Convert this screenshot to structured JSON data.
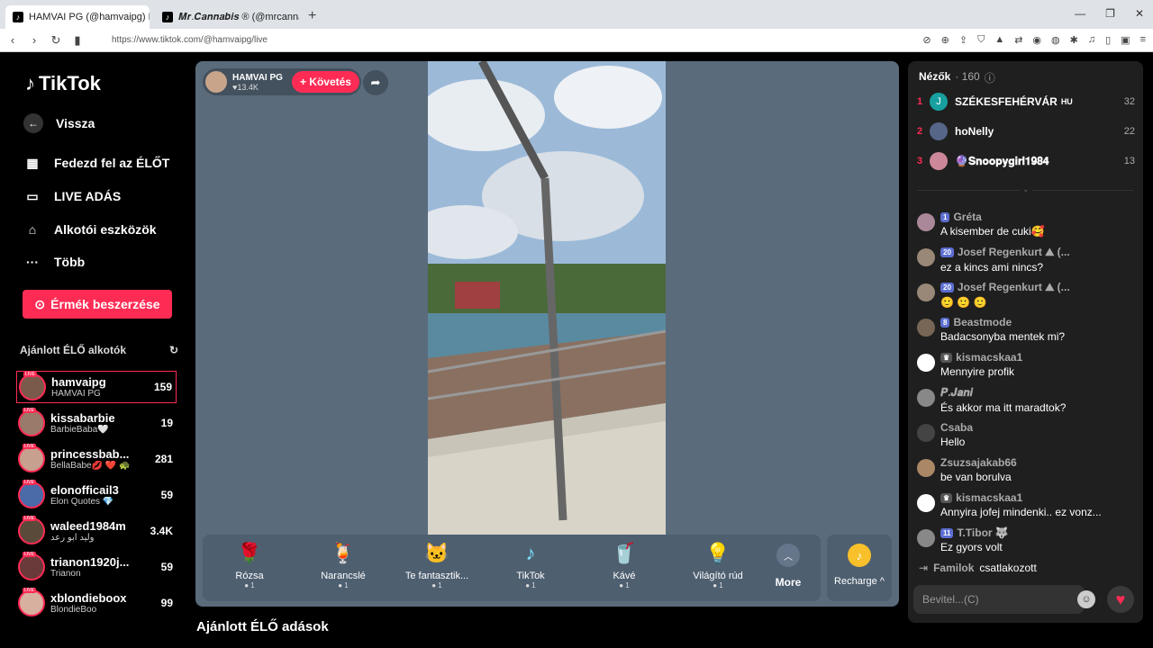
{
  "browser": {
    "tabs": [
      {
        "label": "HAMVAI PG (@hamvaipg) ÉL",
        "active": true
      },
      {
        "label": "𝑴𝒓.𝑪𝒂𝒏𝒏𝒂𝒃𝒊𝒔 ® (@mrcannab",
        "active": false
      }
    ],
    "url": "https://www.tiktok.com/@hamvaipg/live"
  },
  "sidebar": {
    "logo": "TikTok",
    "back": "Vissza",
    "nav": [
      "Fedezd fel az ÉLŐT",
      "LIVE ADÁS",
      "Alkotói eszközök",
      "Több"
    ],
    "coins_button": "Érmék beszerzése",
    "recommended_title": "Ajánlott ÉLŐ alkotók",
    "creators": [
      {
        "name": "hamvaipg",
        "sub": "HAMVAI PG",
        "count": "159",
        "selected": true,
        "color": "#7a5a4a"
      },
      {
        "name": "kissabarbie",
        "sub": "BarbieBaba🤍",
        "count": "19",
        "color": "#9a7a6a"
      },
      {
        "name": "princessbab...",
        "sub": "BellaBabe💋 ❤️ 🐢",
        "count": "281",
        "color": "#c8a090"
      },
      {
        "name": "elonofficail3",
        "sub": "Elon Quotes 💎",
        "count": "59",
        "color": "#4a6aa8"
      },
      {
        "name": "waleed1984m",
        "sub": "وليد ابو رعد",
        "count": "3.4K",
        "color": "#5a4a3a"
      },
      {
        "name": "trianon1920j...",
        "sub": "Trianon",
        "count": "59",
        "color": "#6a3a3a"
      },
      {
        "name": "xblondieboox",
        "sub": "BlondieBoo",
        "count": "99",
        "color": "#d8b0a0"
      }
    ]
  },
  "player": {
    "host_name": "HAMVAI PG",
    "host_likes": "♥13.4K",
    "follow": "+ Követés",
    "gifts": [
      {
        "icon": "🌹",
        "name": "Rózsa",
        "price": "1"
      },
      {
        "icon": "🍹",
        "name": "Narancslé",
        "price": "1"
      },
      {
        "icon": "🐱",
        "name": "Te fantasztik...",
        "price": "1"
      },
      {
        "icon": "♪",
        "name": "TikTok",
        "price": "1"
      },
      {
        "icon": "🥤",
        "name": "Kávé",
        "price": "1"
      },
      {
        "icon": "💡",
        "name": "Világító rúd",
        "price": "1"
      }
    ],
    "more": "More",
    "recharge": "Recharge ^",
    "below_title": "Ajánlott ÉLŐ adások"
  },
  "chat": {
    "viewers_label": "Nézők",
    "viewers_count": "· 160",
    "ranking": [
      {
        "rank": "1",
        "name": "SZÉKESFEHÉRVÁR",
        "suffix": "HU",
        "count": "32",
        "color": "#18a0a0",
        "initial": "J"
      },
      {
        "rank": "2",
        "name": "hoNelly",
        "count": "22",
        "color": "#556688"
      },
      {
        "rank": "3",
        "name": "🔮𝐒𝐧𝐨𝐨𝐩𝐲𝐠𝐢𝐫𝐥𝟏𝟗𝟖𝟒",
        "count": "13",
        "color": "#cc8899"
      }
    ],
    "messages": [
      {
        "badge": "1",
        "user": "Gréta",
        "text": "A kisember de cuki🥰",
        "color": "#aa8899"
      },
      {
        "badge": "20",
        "user": "Josef Regenkurt ⛰ (...",
        "text": "ez a kincs ami nincs?",
        "color": "#998877"
      },
      {
        "badge": "20",
        "user": "Josef Regenkurt ⛰ (...",
        "text": "🙂 🙂 🙂",
        "color": "#998877"
      },
      {
        "badge": "8",
        "user": "Beastmode",
        "text": "Badacsonyba mentek mi?",
        "color": "#776655"
      },
      {
        "badge": "",
        "user": "kismacskaa1",
        "text": "Mennyire profik",
        "color": "#ffffff"
      },
      {
        "badge": "",
        "user": "𝑷.𝑱𝒂𝒏𝒊",
        "text": "És akkor ma itt maradtok?",
        "color": "#888888"
      },
      {
        "badge": "",
        "user": "Csaba",
        "text": "Hello",
        "color": "#444444"
      },
      {
        "badge": "",
        "user": "Zsuzsajakab66",
        "text": "be van borulva",
        "color": "#aa8866"
      },
      {
        "badge": "",
        "user": "kismacskaa1",
        "text": "Annyira jofej mindenki.. ez vonz...",
        "color": "#ffffff"
      },
      {
        "badge": "11",
        "user": "T.Tibor 🐺",
        "text": "Ez gyors volt",
        "color": "#888888"
      }
    ],
    "joined_user": "Familok",
    "joined_text": "csatlakozott",
    "input_placeholder": "Bevitel...(C)"
  }
}
